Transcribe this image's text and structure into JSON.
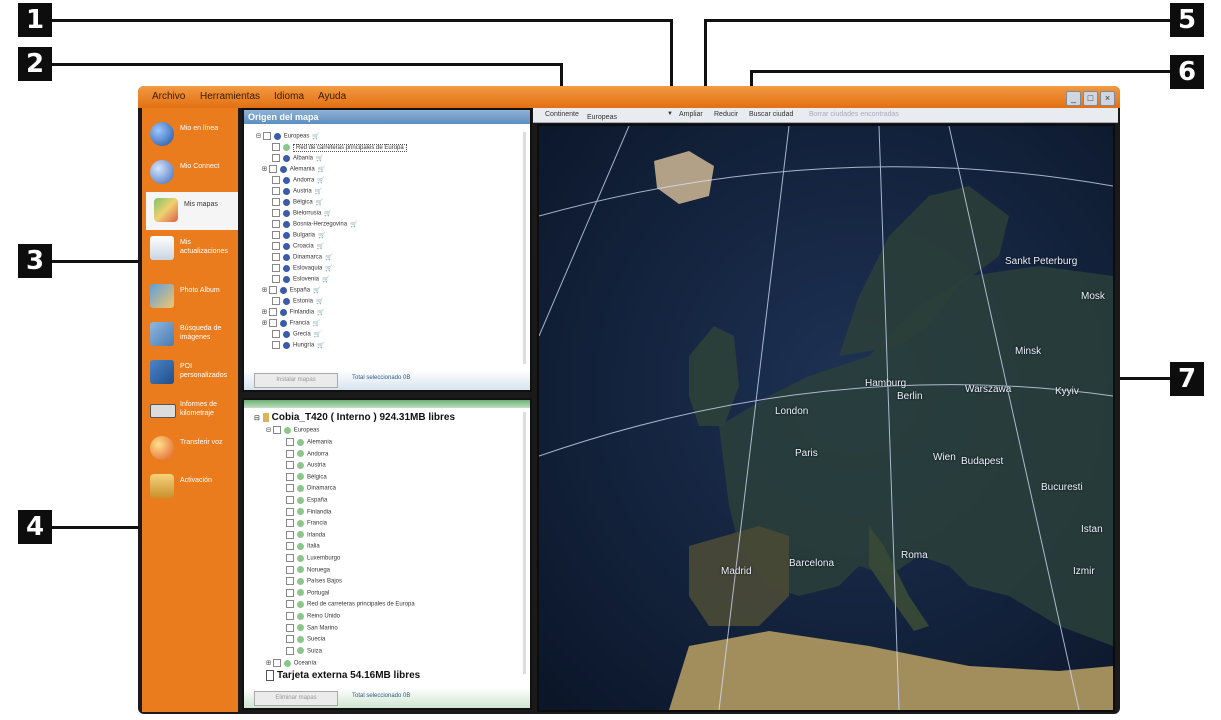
{
  "callouts": [
    "1",
    "2",
    "3",
    "4",
    "5",
    "6",
    "7"
  ],
  "menu": [
    "Archivo",
    "Herramientas",
    "Idioma",
    "Ayuda"
  ],
  "window_buttons": [
    "_",
    "□",
    "×"
  ],
  "sidebar": {
    "items": [
      {
        "label": "Mio en línea",
        "icon": "globe-icon"
      },
      {
        "label": "Mio Connect",
        "icon": "connect-icon"
      },
      {
        "label": "Mis mapas",
        "icon": "map-icon"
      },
      {
        "label": "Mis actualizaciones",
        "icon": "envelope-icon"
      },
      {
        "label": "Photo Album",
        "icon": "photo-icon"
      },
      {
        "label": "Búsqueda de imágenes",
        "icon": "image-search-icon"
      },
      {
        "label": "POI personalizados",
        "icon": "poi-icon"
      },
      {
        "label": "Informes de kilometraje",
        "icon": "odometer-icon"
      },
      {
        "label": "Transferir voz",
        "icon": "voice-icon"
      },
      {
        "label": "Activación",
        "icon": "activation-icon"
      }
    ]
  },
  "map_source": {
    "title": "Origen del mapa",
    "items": [
      "Europeas",
      "Red de carreteras principales de Europa",
      "Albania",
      "Alemania",
      "Andorra",
      "Austria",
      "Bélgica",
      "Bielorrusia",
      "Bosnia-Herzegovina",
      "Bulgaria",
      "Croacia",
      "Dinamarca",
      "Eslovaquia",
      "Eslovenia",
      "España",
      "Estonia",
      "Finlandia",
      "Francia",
      "Grecia",
      "Hungría"
    ],
    "button": "Instalar mapas",
    "total": "Total seleccionado 0B"
  },
  "device": {
    "drive": "Cobia_T420 ( Interno ) 924.31MB libres",
    "items": [
      "Europeas",
      "Alemania",
      "Andorra",
      "Austria",
      "Bélgica",
      "Dinamarca",
      "España",
      "Finlandia",
      "Francia",
      "Irlanda",
      "Italia",
      "Luxemburgo",
      "Noruega",
      "Países Bajos",
      "Portugal",
      "Red de carreteras principales de Europa",
      "Reino Unido",
      "San Marino",
      "Suecia",
      "Suiza",
      "Oceanía"
    ],
    "card": "Tarjeta externa 54.16MB libres",
    "button": "Eliminar mapas",
    "total": "Total seleccionado 0B"
  },
  "toolbar": {
    "continent_label": "Continente",
    "continent_value": "Europeas",
    "zoom_in": "Ampliar",
    "zoom_out": "Reducir",
    "search_city": "Buscar ciudad",
    "clear_found": "Borrar ciudades encontradas"
  },
  "map": {
    "cities": [
      "Sankt Peterburg",
      "Mosk",
      "Minsk",
      "Hamburg",
      "Berlin",
      "Warszawa",
      "Kyyiv",
      "London",
      "Paris",
      "Wien",
      "Budapest",
      "Bucuresti",
      "Istan",
      "Madrid",
      "Barcelona",
      "Roma",
      "Izmir"
    ]
  }
}
